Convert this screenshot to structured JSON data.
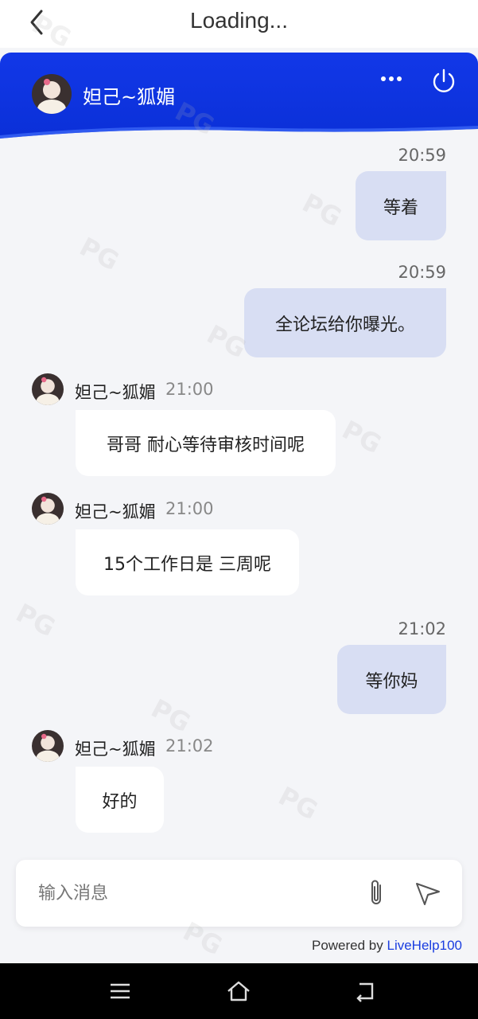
{
  "topbar": {
    "title": "Loading..."
  },
  "header": {
    "agent_name": "妲己~狐媚"
  },
  "messages": [
    {
      "side": "right",
      "time": "20:59",
      "text": "等着"
    },
    {
      "side": "right",
      "time": "20:59",
      "text": "全论坛给你曝光。"
    },
    {
      "side": "left",
      "sender": "妲己~狐媚",
      "time": "21:00",
      "text": "哥哥 耐心等待审核时间呢"
    },
    {
      "side": "left",
      "sender": "妲己~狐媚",
      "time": "21:00",
      "text": "15个工作日是 三周呢"
    },
    {
      "side": "right",
      "time": "21:02",
      "text": "等你妈"
    },
    {
      "side": "left",
      "sender": "妲己~狐媚",
      "time": "21:02",
      "text": "好的"
    }
  ],
  "composer": {
    "placeholder": "输入消息"
  },
  "footer": {
    "powered_prefix": "Powered by ",
    "brand": "LiveHelp100"
  },
  "watermark": "PG",
  "colors": {
    "header": "#0a2fd6",
    "bubble_out": "#d8def3",
    "bubble_in": "#ffffff",
    "brand": "#1a3de0"
  }
}
